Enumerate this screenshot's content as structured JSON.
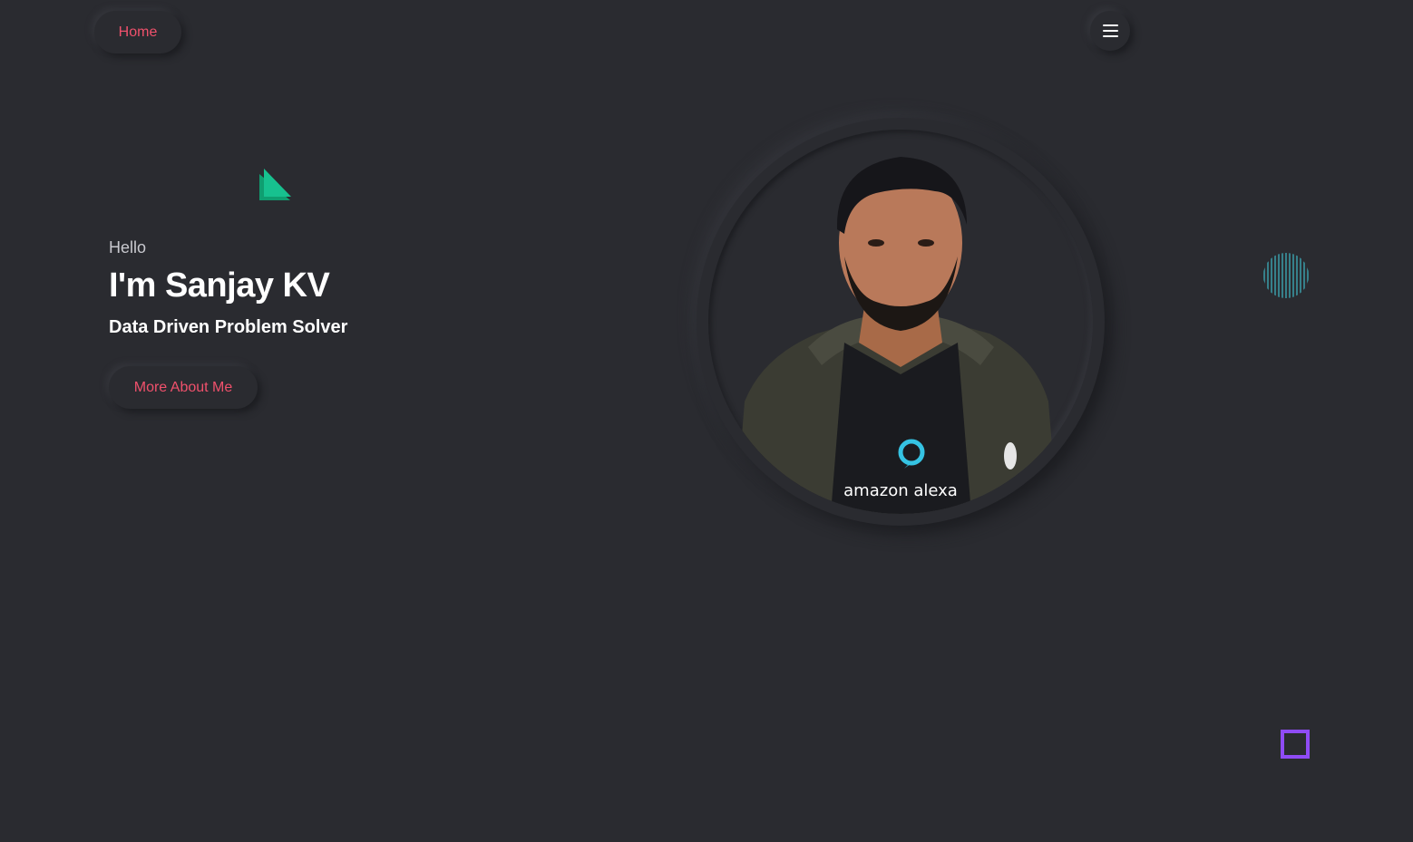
{
  "nav": {
    "home_label": "Home",
    "menu_icon": "hamburger-menu-icon"
  },
  "hero": {
    "greeting": "Hello",
    "name": "I'm Sanjay KV",
    "tagline": "Data Driven Problem Solver",
    "cta_label": "More About Me"
  },
  "portrait": {
    "shirt_text": "amazon alexa"
  },
  "colors": {
    "background": "#2a2b30",
    "accent": "#f0516c",
    "triangle": "#17c18f",
    "stripes": "#3fb8c6",
    "square": "#8f4bf5"
  }
}
